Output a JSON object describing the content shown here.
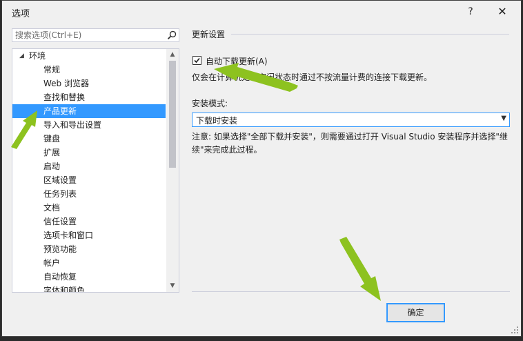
{
  "window": {
    "title": "选项",
    "help_label": "?",
    "close_label": "✕"
  },
  "search": {
    "placeholder": "搜索选项(Ctrl+E)"
  },
  "tree": {
    "root": "环境",
    "items": [
      "常规",
      "Web 浏览器",
      "查找和替换",
      "产品更新",
      "导入和导出设置",
      "键盘",
      "扩展",
      "启动",
      "区域设置",
      "任务列表",
      "文档",
      "信任设置",
      "选项卡和窗口",
      "预览功能",
      "帐户",
      "自动恢复",
      "字体和颜色"
    ],
    "selected": "产品更新"
  },
  "panel": {
    "group_title": "更新设置",
    "auto_download_label": "自动下载更新(A)",
    "auto_download_checked": true,
    "description": "仅会在计算机处于空闲状态时通过不按流量计费的连接下载更新。",
    "mode_label": "安装模式:",
    "mode_value": "下载时安装",
    "note": "注意: 如果选择\"全部下载并安装\"，则需要通过打开 Visual Studio 安装程序并选择\"继续\"来完成此过程。"
  },
  "footer": {
    "ok_label": "确定"
  },
  "colors": {
    "selection": "#3399ff",
    "annotation_arrow": "#8dc21f"
  }
}
